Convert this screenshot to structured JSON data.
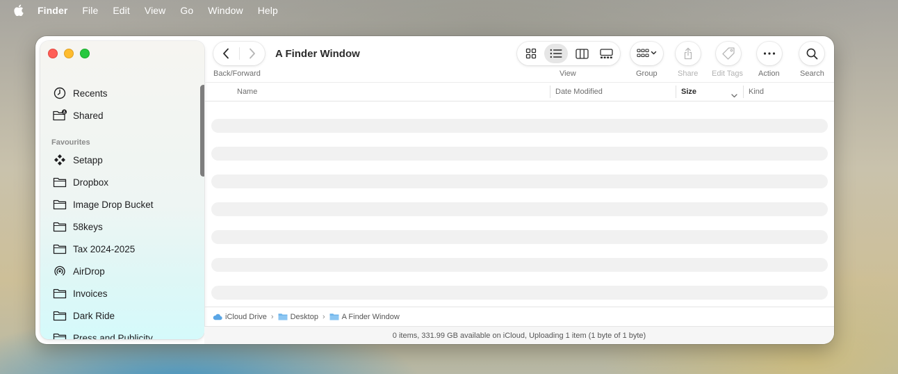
{
  "menubar": {
    "app": "Finder",
    "items": [
      "File",
      "Edit",
      "View",
      "Go",
      "Window",
      "Help"
    ]
  },
  "window": {
    "title": "A Finder Window"
  },
  "toolbar": {
    "back_forward_label": "Back/Forward",
    "view_label": "View",
    "group_label": "Group",
    "share_label": "Share",
    "edit_tags_label": "Edit Tags",
    "action_label": "Action",
    "search_label": "Search",
    "active_view": "list"
  },
  "sidebar": {
    "top_items": [
      {
        "label": "Recents",
        "icon": "clock-icon"
      },
      {
        "label": "Shared",
        "icon": "shared-folder-icon"
      }
    ],
    "favourites_title": "Favourites",
    "favourites": [
      {
        "label": "Setapp",
        "icon": "setapp-icon"
      },
      {
        "label": "Dropbox",
        "icon": "folder-icon"
      },
      {
        "label": "Image Drop Bucket",
        "icon": "folder-icon"
      },
      {
        "label": "58keys",
        "icon": "folder-icon"
      },
      {
        "label": "Tax 2024-2025",
        "icon": "folder-icon"
      },
      {
        "label": "AirDrop",
        "icon": "airdrop-icon"
      },
      {
        "label": "Invoices",
        "icon": "folder-icon"
      },
      {
        "label": "Dark Ride",
        "icon": "folder-icon"
      },
      {
        "label": "Press and Publicity",
        "icon": "folder-icon"
      }
    ]
  },
  "columns": {
    "name": "Name",
    "date_modified": "Date Modified",
    "size": "Size",
    "kind": "Kind"
  },
  "pathbar": {
    "crumbs": [
      "iCloud Drive",
      "Desktop",
      "A Finder Window"
    ]
  },
  "statusbar": {
    "text": "0 items, 331.99 GB available on iCloud, Uploading 1 item (1 byte of 1 byte)"
  },
  "colors": {
    "close": "#ff5f57",
    "minimize": "#febc2e",
    "zoom": "#28c840",
    "icloud": "#5aa6e6",
    "folder_blue": "#6db3ea"
  }
}
